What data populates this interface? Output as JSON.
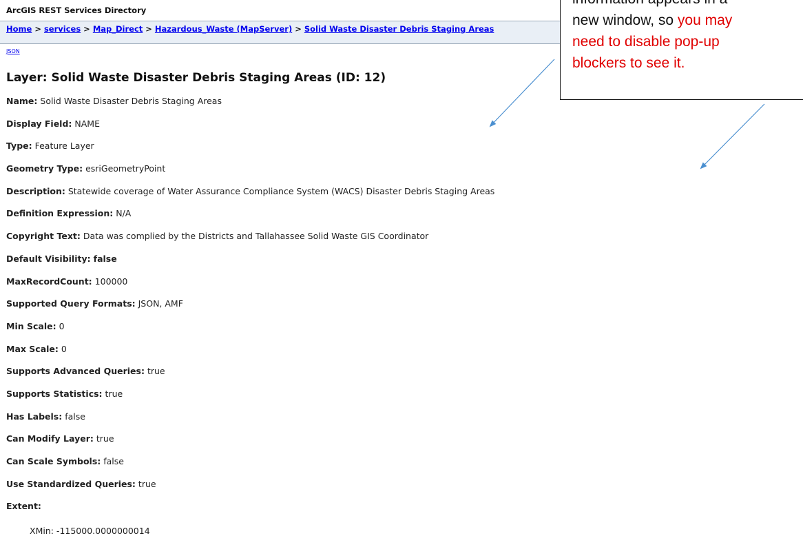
{
  "header": {
    "directory_title": "ArcGIS REST Services Directory"
  },
  "breadcrumb": {
    "home": "Home",
    "services": "services",
    "map_direct": "Map_Direct",
    "hazardous_waste": "Hazardous_Waste (MapServer)",
    "layer": "Solid Waste Disaster Debris Staging Areas",
    "separator": ">"
  },
  "json_link": "JSON",
  "layer_title": "Layer: Solid Waste Disaster Debris Staging Areas (ID: 12)",
  "properties": [
    {
      "label": "Name:",
      "value": "Solid Waste Disaster Debris Staging Areas"
    },
    {
      "label": "Display Field:",
      "value": "NAME"
    },
    {
      "label": "Type:",
      "value": "Feature Layer"
    },
    {
      "label": "Geometry Type:",
      "value": "esriGeometryPoint"
    },
    {
      "label": "Description:",
      "value": "Statewide coverage of Water Assurance Compliance System (WACS) Disaster Debris Staging Areas"
    },
    {
      "label": "Definition Expression:",
      "value": "N/A"
    },
    {
      "label": "Copyright Text:",
      "value": "Data was complied by the Districts and Tallahassee Solid Waste GIS Coordinator"
    },
    {
      "label": "Default Visibility:",
      "value": "false"
    },
    {
      "label": "MaxRecordCount:",
      "value": "100000"
    },
    {
      "label": "Supported Query Formats:",
      "value": "JSON, AMF"
    },
    {
      "label": "Min Scale:",
      "value": "0"
    },
    {
      "label": "Max Scale:",
      "value": "0"
    },
    {
      "label": "Supports Advanced Queries:",
      "value": "true"
    },
    {
      "label": "Supports Statistics:",
      "value": "true"
    },
    {
      "label": "Has Labels:",
      "value": "false"
    },
    {
      "label": "Can Modify Layer:",
      "value": "true"
    },
    {
      "label": "Can Scale Symbols:",
      "value": "false"
    },
    {
      "label": "Use Standardized Queries:",
      "value": "true"
    },
    {
      "label": "Extent:",
      "value": ""
    }
  ],
  "extent": {
    "xmin": "XMin: -115000.0000000014"
  },
  "callout": {
    "line1": "information appears in a",
    "line2_prefix": "new window, so ",
    "line2_red": "you may",
    "line3_red": "need to disable pop-up",
    "line4_red": "blockers to see it."
  },
  "colors": {
    "link": "#0000ee",
    "breadcrumb_bg": "#e9eff6",
    "callout_red": "#e00000",
    "arrow": "#4a8fd0"
  }
}
